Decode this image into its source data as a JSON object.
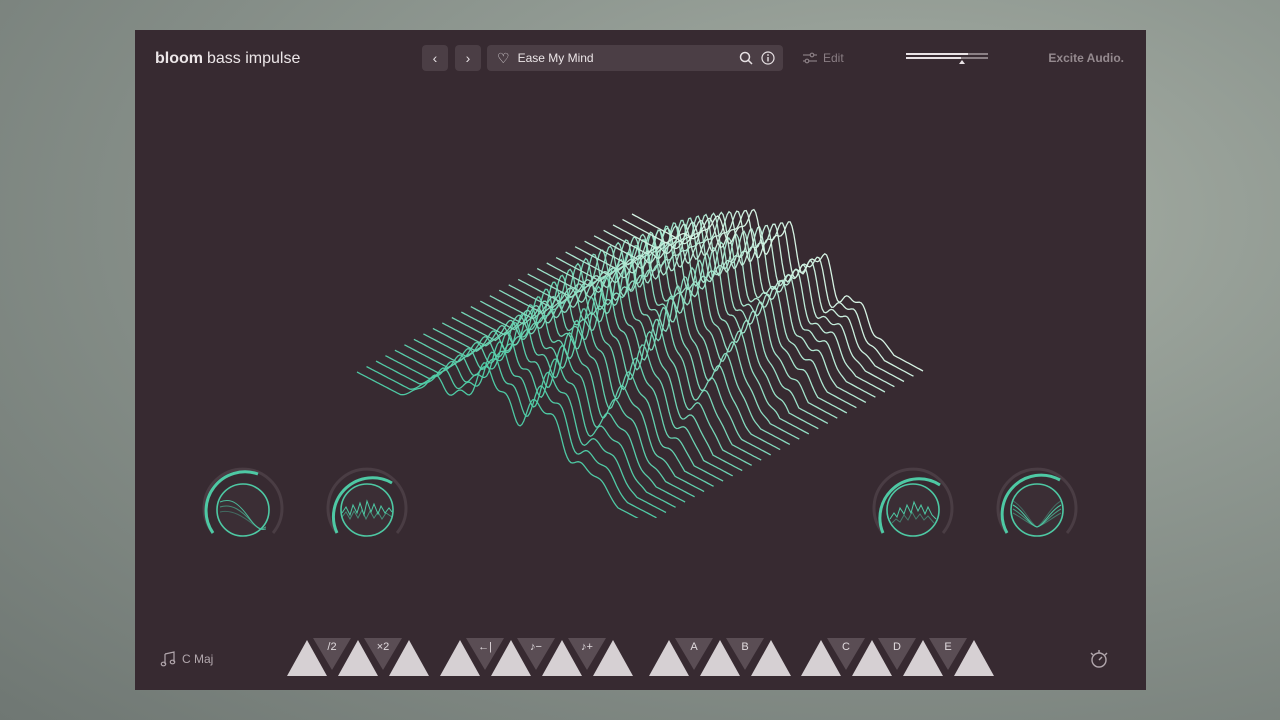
{
  "header": {
    "brand_bold": "bloom",
    "brand_light": "bass impulse",
    "prev_icon": "‹",
    "next_icon": "›",
    "preset_name": "Ease My Mind",
    "edit_label": "Edit",
    "company": "Excite Audio."
  },
  "footer": {
    "key_label": "C Maj",
    "pad_labels": {
      "t1": "/2",
      "t2": "×2",
      "t3": "←|",
      "t4": "♪−",
      "t5": "♪+",
      "t6": "A",
      "t7": "B",
      "t8": "C",
      "t9": "D",
      "t10": "E"
    }
  },
  "colors": {
    "panel": "#372a31",
    "accent": "#4ec9a4",
    "accent_light": "#d6f3e4",
    "triangle": "#d6d0d3",
    "triangle_dark": "#5a4d54"
  }
}
